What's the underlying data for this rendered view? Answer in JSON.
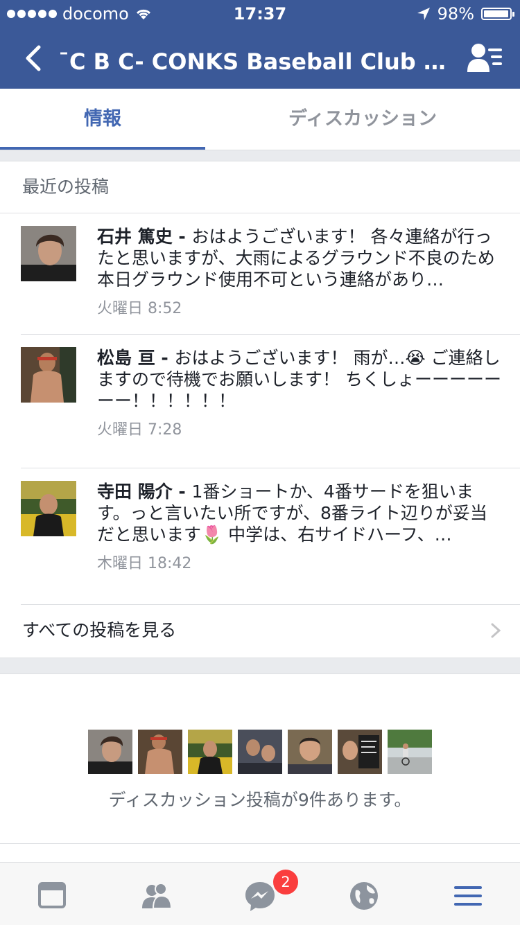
{
  "status_bar": {
    "carrier": "docomo",
    "time": "17:37",
    "battery": "98%",
    "battery_level": 0.98
  },
  "header": {
    "title": "¯C B C- CONKS Baseball Club デ..."
  },
  "tabs": [
    {
      "label": "情報",
      "active": true
    },
    {
      "label": "ディスカッション",
      "active": false
    }
  ],
  "recent_posts": {
    "heading": "最近の投稿",
    "posts": [
      {
        "author": "石井 篤史",
        "separator": " - ",
        "text": "おはようございます！ 各々連絡が行ったと思いますが、大雨によるグラウンド不良のため本日グラウンド使用不可という連絡があり…",
        "time": "火曜日 8:52"
      },
      {
        "author": "松島 亘",
        "separator": " - ",
        "text": "おはようございます！ 雨が…😭 ご連絡しますので待機でお願いします！ ちくしょーーーーーーー！！！！！！",
        "time": "火曜日 7:28"
      },
      {
        "author": "寺田 陽介",
        "separator": " - ",
        "text": "1番ショートか、4番サードを狙います。っと言いたい所ですが、8番ライト辺りが妥当だと思います🌷 中学は、右サイドハーフ、…",
        "time": "木曜日 18:42"
      }
    ],
    "see_all": "すべての投稿を見る"
  },
  "discussion": {
    "summary": "ディスカッション投稿が9件あります。"
  },
  "tab_bar": {
    "messenger_badge": "2"
  },
  "colors": {
    "brand": "#3b5998",
    "accent": "#4267b2",
    "badge": "#fa3e3e"
  }
}
